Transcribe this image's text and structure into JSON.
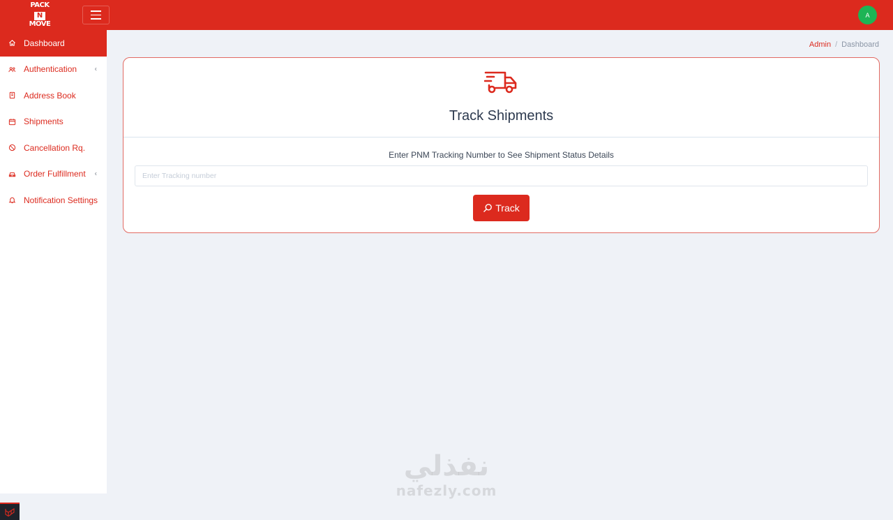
{
  "brand": {
    "logo_line1": "PACK",
    "logo_line2": "N",
    "logo_line3": "MOVE"
  },
  "header": {
    "avatar_initial": "A"
  },
  "sidebar": {
    "items": [
      {
        "label": "Dashboard",
        "icon": "home-icon",
        "active": true
      },
      {
        "label": "Authentication",
        "icon": "users-icon",
        "chevron": "‹"
      },
      {
        "label": "Address Book",
        "icon": "book-icon"
      },
      {
        "label": "Shipments",
        "icon": "calendar-icon"
      },
      {
        "label": "Cancellation Rq.",
        "icon": "ban-icon"
      },
      {
        "label": "Order Fulfillment",
        "icon": "car-icon",
        "chevron": "‹"
      },
      {
        "label": "Notification Settings",
        "icon": "bell-icon"
      }
    ]
  },
  "breadcrumb": {
    "root": "Admin",
    "separator": "/",
    "current": "Dashboard"
  },
  "card": {
    "title": "Track Shipments",
    "hint": "Enter PNM Tracking Number to See Shipment Status Details",
    "input_placeholder": "Enter Tracking number",
    "input_value": "",
    "button_label": "Track"
  },
  "watermark": {
    "arabic": "نفذلي",
    "latin": "nafezly.com"
  },
  "colors": {
    "brand": "#dc2a1e",
    "avatar": "#1db455",
    "background": "#eff2f7"
  }
}
